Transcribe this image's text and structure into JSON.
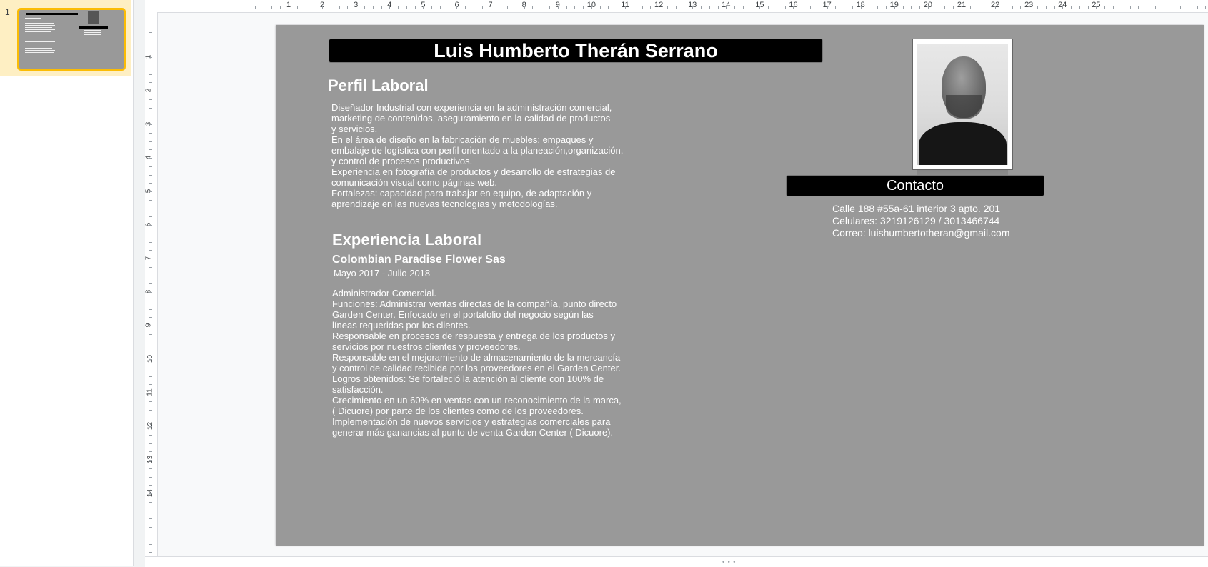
{
  "filmstrip": {
    "slide_number": "1"
  },
  "ruler": {
    "top_numbers": [
      "1",
      "2",
      "3",
      "4",
      "5",
      "6",
      "7",
      "8",
      "9",
      "10",
      "11",
      "12",
      "13",
      "14",
      "15",
      "16",
      "17",
      "18",
      "19",
      "20",
      "21",
      "22",
      "23",
      "24",
      "25"
    ],
    "left_numbers": [
      "1",
      "2",
      "3",
      "4",
      "5",
      "6",
      "7",
      "8",
      "9",
      "10",
      "11",
      "12",
      "13",
      "14"
    ]
  },
  "slide": {
    "name": "Luis Humberto Therán Serrano",
    "perfil_title": "Perfil Laboral",
    "perfil_lines": [
      " Diseñador Industrial con experiencia en la administración comercial,",
      "marketing de contenidos, aseguramiento en la calidad de productos",
      "y servicios.",
      "En el área de diseño en la fabricación de muebles; empaques y",
      "embalaje de logística con perfil orientado a la planeación,organización,",
      "y control de procesos productivos.",
      "Experiencia en fotografía de productos y desarrollo de estrategias de",
      "comunicación visual como páginas web.",
      "Fortalezas: capacidad para trabajar en equipo, de adaptación y",
      "aprendizaje en las nuevas tecnologías y metodologías."
    ],
    "experience_title": "Experiencia Laboral",
    "company": "Colombian Paradise Flower Sas",
    "dates": "Mayo 2017 - Julio 2018",
    "experience_lines": [
      "Administrador Comercial.",
      "Funciones: Administrar ventas directas de la compañía, punto directo",
      "Garden Center. Enfocado en el  portafolio del negocio según las",
      "líneas requeridas por los clientes.",
      "Responsable en procesos de respuesta y entrega  de los productos y",
      "servicios por nuestros clientes y proveedores.",
      "Responsable en el mejoramiento de almacenamiento de la mercancía",
      "y control de calidad recibida por los proveedores en el Garden Center.",
      "Logros obtenidos: Se fortaleció la atención al cliente con 100% de",
      "satisfacción.",
      "Crecimiento en un 60% en ventas con un reconocimiento de la marca,",
      "( Dicuore) por parte de los clientes como de los proveedores.",
      "Implementación de nuevos servicios y estrategias comerciales para",
      "generar más ganancias al punto de venta Garden Center ( Dicuore)."
    ],
    "contact_title": "Contacto",
    "address": "Calle 188 #55a-61 interior 3 apto. 201",
    "phones": "Celulares: 3219126129 / 3013466744",
    "email": "Correo: luishumbertotheran@gmail.com"
  },
  "colors": {
    "slide_background": "#999999",
    "header_bar": "#000000",
    "selected_thumb_border": "#fbbc04",
    "selected_thumb_bg": "#feefc3"
  }
}
